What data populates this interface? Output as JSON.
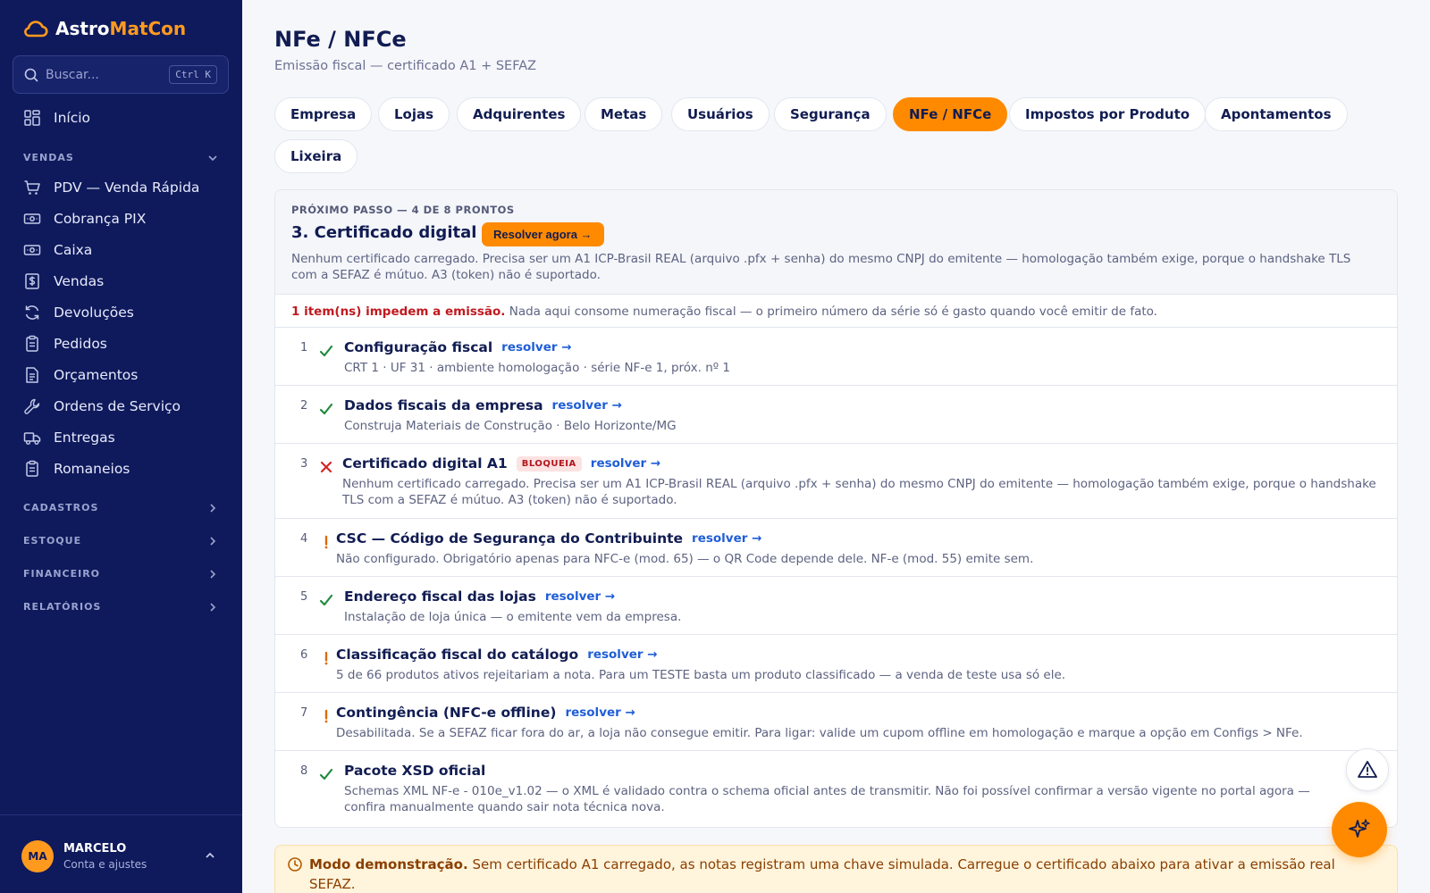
{
  "brand": {
    "name_part1": "Astro",
    "name_part2": "MatCon",
    "accent_color": "#ff8a00",
    "sidebar_bg": "#0f1a5c"
  },
  "search": {
    "placeholder": "Buscar...",
    "shortcut": "Ctrl K",
    "icon": "search-icon"
  },
  "sidebar": {
    "home": {
      "label": "Início",
      "icon": "grid-icon"
    },
    "sections": {
      "vendas": "VENDAS",
      "cadastros": "CADASTROS",
      "estoque": "ESTOQUE",
      "financeiro": "FINANCEIRO",
      "relatorios": "RELATÓRIOS"
    },
    "vendas_items": [
      {
        "label": "PDV — Venda Rápida",
        "icon": "cart-icon"
      },
      {
        "label": "Cobrança PIX",
        "icon": "cash-icon"
      },
      {
        "label": "Caixa",
        "icon": "cash-register-icon"
      },
      {
        "label": "Vendas",
        "icon": "dollar-receipt-icon"
      },
      {
        "label": "Devoluções",
        "icon": "refresh-icon"
      },
      {
        "label": "Pedidos",
        "icon": "clipboard-icon"
      },
      {
        "label": "Orçamentos",
        "icon": "document-icon"
      },
      {
        "label": "Ordens de Serviço",
        "icon": "wrench-icon"
      },
      {
        "label": "Entregas",
        "icon": "truck-icon"
      },
      {
        "label": "Romaneios",
        "icon": "clipboard-list-icon"
      }
    ]
  },
  "user": {
    "initials": "MA",
    "name": "MARCELO",
    "subtitle": "Conta e ajustes"
  },
  "page": {
    "title": "NFe / NFCe",
    "subtitle": "Emissão fiscal — certificado A1 + SEFAZ"
  },
  "tabs": [
    {
      "label": "Empresa",
      "active": false
    },
    {
      "label": "Lojas",
      "active": false
    },
    {
      "label": "Adquirentes",
      "active": false
    },
    {
      "label": "Metas",
      "active": false
    },
    {
      "label": "Usuários",
      "active": false
    },
    {
      "label": "Segurança",
      "active": false
    },
    {
      "label": "NFe / NFCe",
      "active": true
    },
    {
      "label": "Impostos por Produto",
      "active": false
    },
    {
      "label": "Apontamentos",
      "active": false
    },
    {
      "label": "Lixeira",
      "active": false
    }
  ],
  "next_step": {
    "eyebrow": "PRÓXIMO PASSO — 4 DE 8 PRONTOS",
    "title": "3. Certificado digital A1",
    "button": "Resolver agora →",
    "description": "Nenhum certificado carregado. Precisa ser um A1 ICP-Brasil REAL (arquivo .pfx + senha) do mesmo CNPJ do emitente — homologação também exige, porque o handshake TLS com a SEFAZ é mútuo. A3 (token) não é suportado."
  },
  "blocking": {
    "strong": "1 item(ns) impedem a emissão.",
    "rest": "Nada aqui consome numeração fiscal — o primeiro número da série só é gasto quando você emitir de fato."
  },
  "checklist": [
    {
      "num": "1",
      "status": "ok",
      "title": "Configuração fiscal",
      "link": "resolver →",
      "desc": "CRT 1 · UF 31 · ambiente homologação · série NF-e 1, próx. nº 1"
    },
    {
      "num": "2",
      "status": "ok",
      "title": "Dados fiscais da empresa",
      "link": "resolver →",
      "desc": "Construja Materiais de Construção · Belo Horizonte/MG"
    },
    {
      "num": "3",
      "status": "error",
      "title": "Certificado digital A1",
      "badge": "BLOQUEIA",
      "link": "resolver →",
      "desc": "Nenhum certificado carregado. Precisa ser um A1 ICP-Brasil REAL (arquivo .pfx + senha) do mesmo CNPJ do emitente — homologação também exige, porque o handshake TLS com a SEFAZ é mútuo. A3 (token) não é suportado."
    },
    {
      "num": "4",
      "status": "warn",
      "title": "CSC — Código de Segurança do Contribuinte",
      "link": "resolver →",
      "desc": "Não configurado. Obrigatório apenas para NFC-e (mod. 65) — o QR Code depende dele. NF-e (mod. 55) emite sem."
    },
    {
      "num": "5",
      "status": "ok",
      "title": "Endereço fiscal das lojas",
      "link": "resolver →",
      "desc": "Instalação de loja única — o emitente vem da empresa."
    },
    {
      "num": "6",
      "status": "warn",
      "title": "Classificação fiscal do catálogo",
      "link": "resolver →",
      "desc": "5 de 66 produtos ativos rejeitariam a nota. Para um TESTE basta um produto classificado — a venda de teste usa só ele."
    },
    {
      "num": "7",
      "status": "warn",
      "title": "Contingência (NFC-e offline)",
      "link": "resolver →",
      "desc": "Desabilitada. Se a SEFAZ ficar fora do ar, a loja não consegue emitir. Para ligar: valide um cupom offline em homologação e marque a opção em Configs > NFe."
    },
    {
      "num": "8",
      "status": "ok",
      "title": "Pacote XSD oficial",
      "desc": "Schemas XML NF-e - 010e_v1.02 — o XML é validado contra o schema oficial antes de transmitir. Não foi possível confirmar a versão vigente no portal agora — confira manualmente quando sair nota técnica nova."
    }
  ],
  "demo": {
    "strong": "Modo demonstração.",
    "rest": "Sem certificado A1 carregado, as notas registram uma chave simulada. Carregue o certificado abaixo para ativar a emissão real SEFAZ."
  },
  "status_colors": {
    "ok": "#1f8a3e",
    "error": "#d42525",
    "warn": "#e06b00"
  }
}
